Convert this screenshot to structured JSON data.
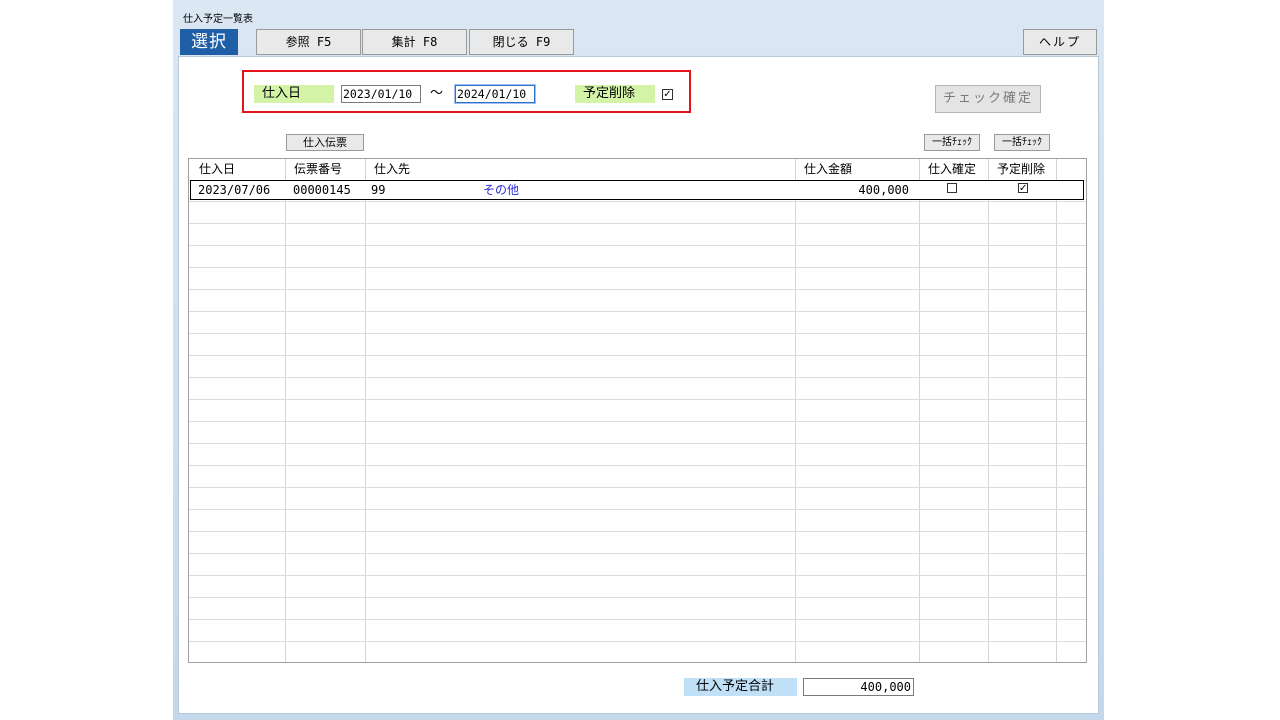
{
  "window": {
    "title": "仕入予定一覧表"
  },
  "toolbar": {
    "select_label": "選択",
    "reference_label": "参照 F5",
    "aggregate_label": "集計 F8",
    "close_label": "閉じる F9",
    "help_label": "ヘルプ"
  },
  "filter": {
    "date_label": "仕入日",
    "date_from": "2023/01/10",
    "range_sep": "～",
    "date_to": "2024/01/10",
    "delete_label": "予定削除",
    "delete_checked": true
  },
  "check_confirm_label": "チェック確定",
  "voucher_button_label": "仕入伝票",
  "bulk_check_1_label": "一括ﾁｪｯｸ",
  "bulk_check_2_label": "一括ﾁｪｯｸ",
  "table": {
    "columns": [
      "仕入日",
      "伝票番号",
      "仕入先",
      "仕入金額",
      "仕入確定",
      "予定削除"
    ],
    "rows": [
      {
        "date": "2023/07/06",
        "voucher_no": "00000145",
        "supplier_code": "99",
        "supplier_name": "その他",
        "amount": "400,000",
        "confirmed": false,
        "delete": true
      }
    ]
  },
  "total": {
    "label": "仕入予定合計",
    "value": "400,000"
  }
}
